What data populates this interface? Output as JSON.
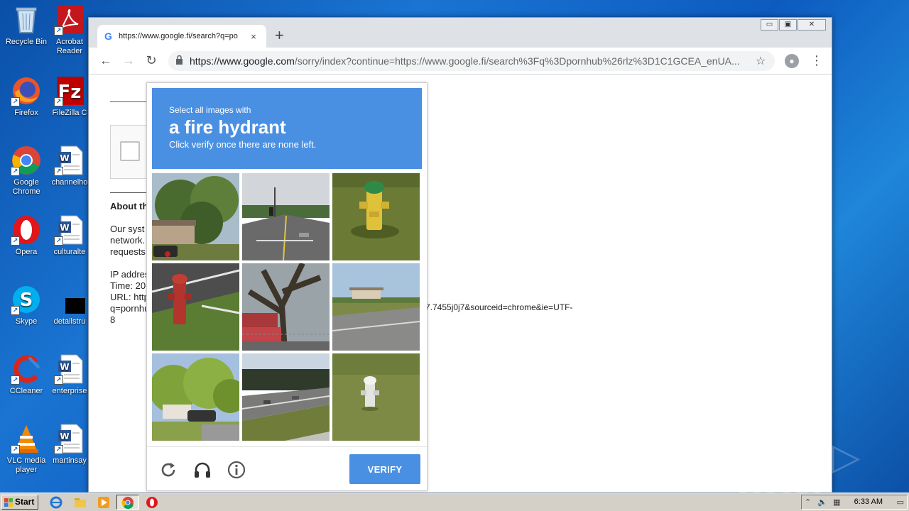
{
  "desktop": {
    "icons": [
      {
        "label": "Recycle Bin",
        "icon": "recycle-bin-icon"
      },
      {
        "label": "Acrobat Reader",
        "icon": "acrobat-icon"
      },
      {
        "label": "Firefox",
        "icon": "firefox-icon"
      },
      {
        "label": "FileZilla C",
        "icon": "filezilla-icon"
      },
      {
        "label": "Google Chrome",
        "icon": "chrome-icon"
      },
      {
        "label": "channelho",
        "icon": "word-doc-icon"
      },
      {
        "label": "Opera",
        "icon": "opera-icon"
      },
      {
        "label": "culturalte",
        "icon": "word-doc-icon"
      },
      {
        "label": "Skype",
        "icon": "skype-icon"
      },
      {
        "label": "detailstru",
        "icon": "black-file-icon"
      },
      {
        "label": "CCleaner",
        "icon": "ccleaner-icon"
      },
      {
        "label": "enterprise",
        "icon": "word-doc-icon"
      },
      {
        "label": "VLC media player",
        "icon": "vlc-icon"
      },
      {
        "label": "martinsay",
        "icon": "word-doc-icon"
      }
    ]
  },
  "browser": {
    "tab_title": "https://www.google.fi/search?q=po",
    "tab_close": "×",
    "new_tab": "+",
    "url_host": "https://www.google.com",
    "url_rest": "/sorry/index?continue=https://www.google.fi/search%3Fq%3Dpornhub%26rlz%3D1C1GCEA_enUA...",
    "win_min": "▭",
    "win_max": "▣",
    "win_close": "✕"
  },
  "page": {
    "about_heading": "About th",
    "system_text": [
      "Our syst",
      "network.",
      "requests"
    ],
    "info_text": [
      "IP addres",
      "Time: 20",
      "URL: http",
      "q=pornhu",
      "8"
    ],
    "url_tail": "7.7455j0j7&sourceid=chrome&ie=UTF-"
  },
  "captcha": {
    "instruction_pre": "Select all images with",
    "target": "a fire hydrant",
    "instruction_post": "Click verify once there are none left.",
    "verify_label": "VERIFY",
    "tiles": [
      {
        "name": "tile-trees-house"
      },
      {
        "name": "tile-road-intersection"
      },
      {
        "name": "tile-yellow-hydrant"
      },
      {
        "name": "tile-red-hydrant"
      },
      {
        "name": "tile-tree-parking"
      },
      {
        "name": "tile-highway-building"
      },
      {
        "name": "tile-green-trees-car"
      },
      {
        "name": "tile-highway-overpass"
      },
      {
        "name": "tile-white-hydrant"
      }
    ]
  },
  "watermark": "ANY ▷ RUN",
  "taskbar": {
    "start_label": "Start",
    "clock": "6:33 AM"
  },
  "colors": {
    "captcha_blue": "#4a90e2",
    "desktop_blue": "#1a74d2"
  }
}
